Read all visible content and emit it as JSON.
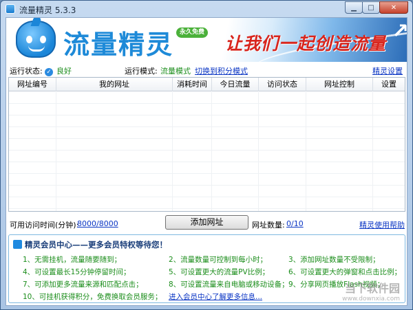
{
  "window": {
    "title": "流量精灵 5.3.3"
  },
  "banner": {
    "brand": "流量精灵",
    "badge": "永久免费",
    "slogan": "让我们一起创造流量"
  },
  "status": {
    "run_state_label": "运行状态:",
    "run_state_value": "良好",
    "run_mode_label": "运行模式:",
    "run_mode_value": "流量模式",
    "switch_link": "切换到积分模式",
    "settings_link": "精灵设置"
  },
  "table": {
    "columns": [
      "网址编号",
      "我的网址",
      "消耗时间",
      "今日流量",
      "访问状态",
      "网址控制",
      "设置"
    ]
  },
  "controls": {
    "time_label": "可用访问时间(分钟):",
    "time_value": "8000/8000",
    "add_button": "添加网址",
    "count_label": "网址数量:",
    "count_value": "0/10",
    "help_link": "精灵使用帮助"
  },
  "member": {
    "header": "精灵会员中心——更多会员特权等待您！",
    "features": [
      "1、无需挂机，流量随要随到；",
      "2、流量数量可控制到每小时；",
      "3、添加网址数量不受限制；",
      "4、可设置最长15分钟停留时间；",
      "5、可设置更大的流量PV比例；",
      "6、可设置更大的弹窗和点击比例；",
      "7、可添加更多流量来源和匹配点击；",
      "8、可设置流量来自电脑或移动设备；",
      "9、分享网页播放Flash视频；",
      "10、可挂机获得积分，免费换取会员服务；"
    ],
    "more_link": "进入会员中心了解更多信息..."
  },
  "watermark": {
    "text": "当下软件园",
    "sub": "www.downxia.com"
  }
}
